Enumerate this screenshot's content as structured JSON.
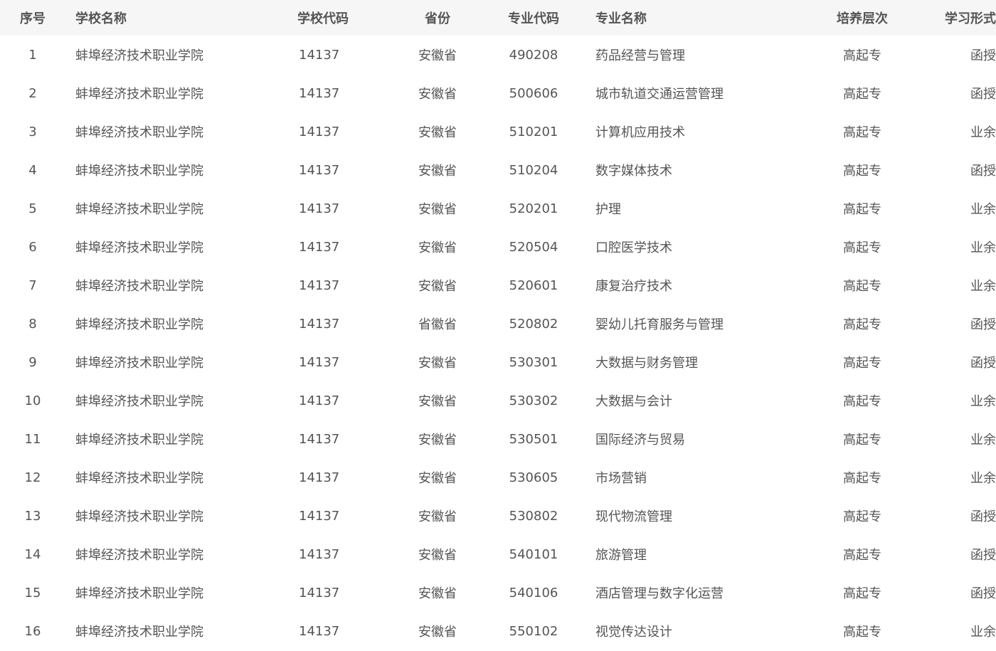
{
  "headers": {
    "index": "序号",
    "school_name": "学校名称",
    "school_code": "学校代码",
    "province": "省份",
    "major_code": "专业代码",
    "major_name": "专业名称",
    "level": "培养层次",
    "study_mode": "学习形式"
  },
  "rows": [
    {
      "index": "1",
      "school_name": "蚌埠经济技术职业学院",
      "school_code": "14137",
      "province": "安徽省",
      "major_code": "490208",
      "major_name": "药品经营与管理",
      "level": "高起专",
      "study_mode": "函授"
    },
    {
      "index": "2",
      "school_name": "蚌埠经济技术职业学院",
      "school_code": "14137",
      "province": "安徽省",
      "major_code": "500606",
      "major_name": "城市轨道交通运营管理",
      "level": "高起专",
      "study_mode": "函授"
    },
    {
      "index": "3",
      "school_name": "蚌埠经济技术职业学院",
      "school_code": "14137",
      "province": "安徽省",
      "major_code": "510201",
      "major_name": "计算机应用技术",
      "level": "高起专",
      "study_mode": "业余"
    },
    {
      "index": "4",
      "school_name": "蚌埠经济技术职业学院",
      "school_code": "14137",
      "province": "安徽省",
      "major_code": "510204",
      "major_name": "数字媒体技术",
      "level": "高起专",
      "study_mode": "函授"
    },
    {
      "index": "5",
      "school_name": "蚌埠经济技术职业学院",
      "school_code": "14137",
      "province": "安徽省",
      "major_code": "520201",
      "major_name": "护理",
      "level": "高起专",
      "study_mode": "业余"
    },
    {
      "index": "6",
      "school_name": "蚌埠经济技术职业学院",
      "school_code": "14137",
      "province": "安徽省",
      "major_code": "520504",
      "major_name": "口腔医学技术",
      "level": "高起专",
      "study_mode": "业余"
    },
    {
      "index": "7",
      "school_name": "蚌埠经济技术职业学院",
      "school_code": "14137",
      "province": "安徽省",
      "major_code": "520601",
      "major_name": "康复治疗技术",
      "level": "高起专",
      "study_mode": "业余"
    },
    {
      "index": "8",
      "school_name": "蚌埠经济技术职业学院",
      "school_code": "14137",
      "province": "省徽省",
      "major_code": "520802",
      "major_name": "婴幼儿托育服务与管理",
      "level": "高起专",
      "study_mode": "函授"
    },
    {
      "index": "9",
      "school_name": "蚌埠经济技术职业学院",
      "school_code": "14137",
      "province": "安徽省",
      "major_code": "530301",
      "major_name": "大数据与财务管理",
      "level": "高起专",
      "study_mode": "函授"
    },
    {
      "index": "10",
      "school_name": "蚌埠经济技术职业学院",
      "school_code": "14137",
      "province": "安徽省",
      "major_code": "530302",
      "major_name": "大数据与会计",
      "level": "高起专",
      "study_mode": "业余"
    },
    {
      "index": "11",
      "school_name": "蚌埠经济技术职业学院",
      "school_code": "14137",
      "province": "安徽省",
      "major_code": "530501",
      "major_name": "国际经济与贸易",
      "level": "高起专",
      "study_mode": "业余"
    },
    {
      "index": "12",
      "school_name": "蚌埠经济技术职业学院",
      "school_code": "14137",
      "province": "安徽省",
      "major_code": "530605",
      "major_name": "市场营销",
      "level": "高起专",
      "study_mode": "业余"
    },
    {
      "index": "13",
      "school_name": "蚌埠经济技术职业学院",
      "school_code": "14137",
      "province": "安徽省",
      "major_code": "530802",
      "major_name": "现代物流管理",
      "level": "高起专",
      "study_mode": "函授"
    },
    {
      "index": "14",
      "school_name": "蚌埠经济技术职业学院",
      "school_code": "14137",
      "province": "安徽省",
      "major_code": "540101",
      "major_name": "旅游管理",
      "level": "高起专",
      "study_mode": "函授"
    },
    {
      "index": "15",
      "school_name": "蚌埠经济技术职业学院",
      "school_code": "14137",
      "province": "安徽省",
      "major_code": "540106",
      "major_name": "酒店管理与数字化运营",
      "level": "高起专",
      "study_mode": "函授"
    },
    {
      "index": "16",
      "school_name": "蚌埠经济技术职业学院",
      "school_code": "14137",
      "province": "安徽省",
      "major_code": "550102",
      "major_name": "视觉传达设计",
      "level": "高起专",
      "study_mode": "业余"
    }
  ]
}
